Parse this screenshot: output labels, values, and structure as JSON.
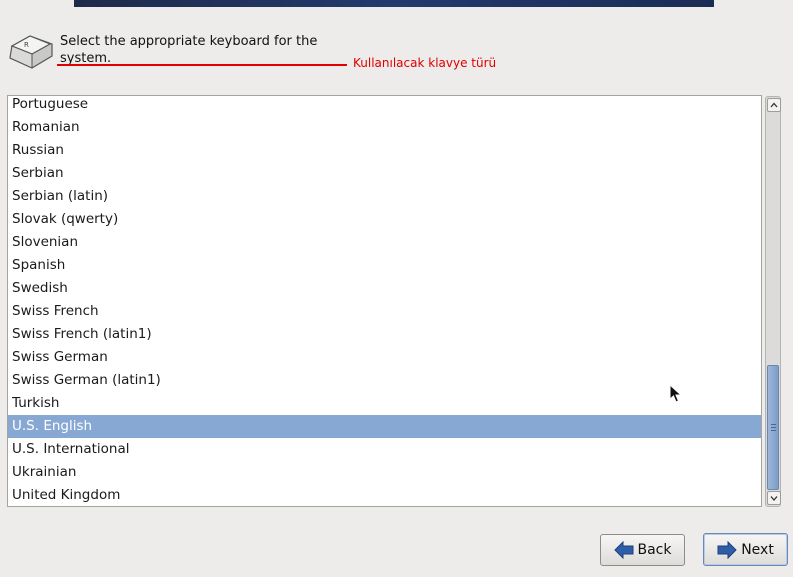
{
  "header": {
    "prompt": "Select the appropriate keyboard for the system.",
    "annotation": "Kullanılacak klavye türü"
  },
  "keyboard_list": {
    "items": [
      "Portuguese",
      "Romanian",
      "Russian",
      "Serbian",
      "Serbian (latin)",
      "Slovak (qwerty)",
      "Slovenian",
      "Spanish",
      "Swedish",
      "Swiss French",
      "Swiss French (latin1)",
      "Swiss German",
      "Swiss German (latin1)",
      "Turkish",
      "U.S. English",
      "U.S. International",
      "Ukrainian",
      "United Kingdom"
    ],
    "selected": "U.S. English"
  },
  "buttons": {
    "back_label": "Back",
    "next_label": "Next"
  },
  "colors": {
    "selection": "#86a8d2",
    "annotation": "#e00000",
    "arrow": "#2f5ea8"
  },
  "icons": {
    "keyboard": "keyboard-key-icon",
    "back": "arrow-left-icon",
    "next": "arrow-right-icon"
  }
}
